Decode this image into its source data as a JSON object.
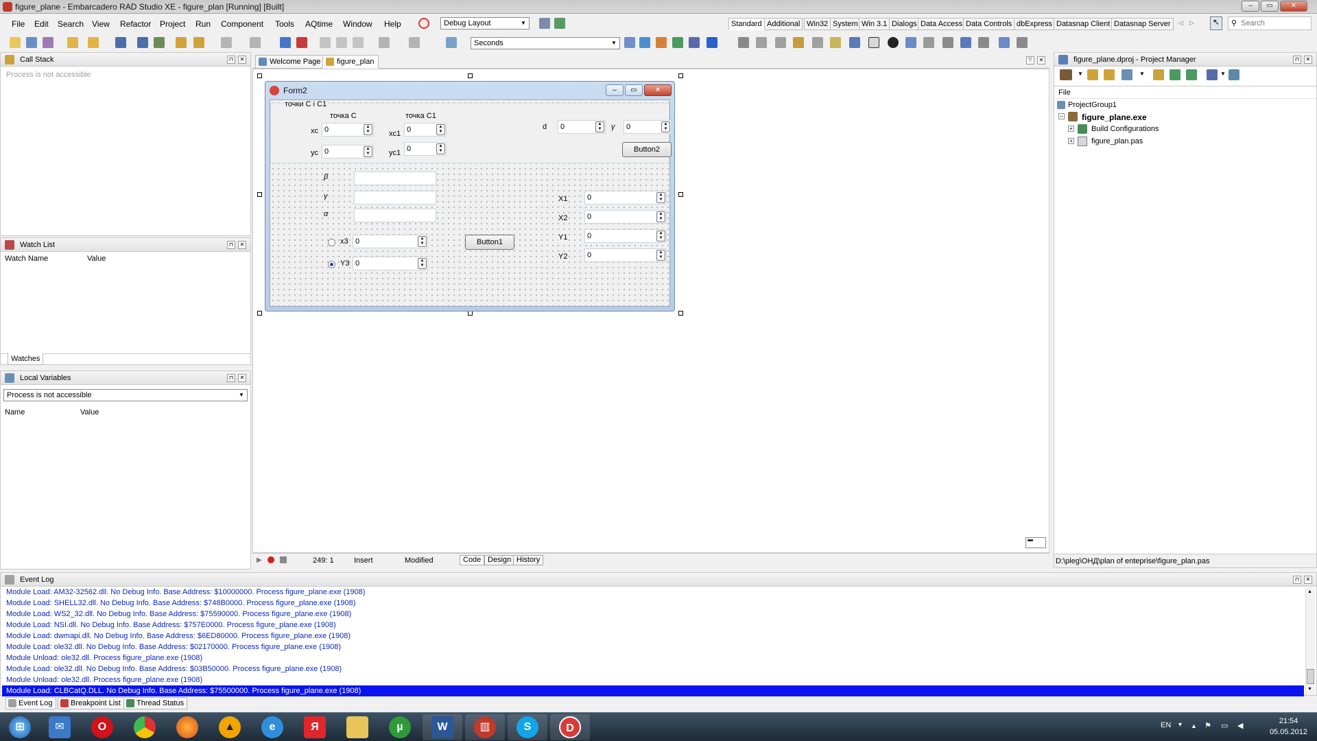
{
  "window": {
    "title": "figure_plane - Embarcadero RAD Studio XE - figure_plan [Running] [Built]"
  },
  "menu": [
    "File",
    "Edit",
    "Search",
    "View",
    "Refactor",
    "Project",
    "Run",
    "Component",
    "Tools",
    "AQtime",
    "Window",
    "Help"
  ],
  "layout_combo": "Debug Layout",
  "toolbar": {
    "timer_combo": "Seconds"
  },
  "palette_tabs": [
    "Standard",
    "Additional",
    "Win32",
    "System",
    "Win 3.1",
    "Dialogs",
    "Data Access",
    "Data Controls",
    "dbExpress",
    "Datasnap Client",
    "Datasnap Server"
  ],
  "search": {
    "placeholder": "Search"
  },
  "call_stack": {
    "title": "Call Stack",
    "message": "Process is not accessible"
  },
  "watch_list": {
    "title": "Watch List",
    "columns": [
      "Watch Name",
      "Value"
    ],
    "tab": "Watches"
  },
  "local_vars": {
    "title": "Local Variables",
    "combo": "Process is not accessible",
    "columns": [
      "Name",
      "Value"
    ]
  },
  "designer_tabs": [
    "Welcome Page",
    "figure_plan"
  ],
  "form": {
    "title": "Form2",
    "group_label": "точки C i C1",
    "point_c_label": "точка C",
    "point_c1_label": "точка C1",
    "xc_label": "xc",
    "yc_label": "yc",
    "xc1_label": "xc1",
    "yc1_label": "yc1",
    "d_label": "d",
    "gamma_top_label": "γ",
    "beta_label": "β",
    "gamma_label": "γ",
    "alpha_label": "α",
    "x3_label": "x3",
    "y3_label": "Y3",
    "x1_label": "X1",
    "x2_label": "X2",
    "y1_label": "Y1",
    "y2_label": "Y2",
    "zero": "0",
    "button1": "Button1",
    "button2": "Button2"
  },
  "editor_status": {
    "position": "249:   1",
    "mode": "Insert",
    "state": "Modified",
    "tabs": [
      "Code",
      "Design",
      "History"
    ]
  },
  "project_manager": {
    "title": "figure_plane.dproj - Project Manager",
    "file_label": "File",
    "tree": [
      "ProjectGroup1",
      "figure_plane.exe",
      "Build Configurations",
      "figure_plan.pas"
    ],
    "path": "D:\\pleg\\ОНД\\plan of enteprise\\figure_plan.pas"
  },
  "event_log": {
    "title": "Event Log",
    "lines": [
      "Module Load: AM32-32562.dll. No Debug Info. Base Address: $10000000. Process figure_plane.exe (1908)",
      "Module Load: SHELL32.dll. No Debug Info. Base Address: $748B0000. Process figure_plane.exe (1908)",
      "Module Load: WS2_32.dll. No Debug Info. Base Address: $75590000. Process figure_plane.exe (1908)",
      "Module Load: NSI.dll. No Debug Info. Base Address: $757E0000. Process figure_plane.exe (1908)",
      "Module Load: dwmapi.dll. No Debug Info. Base Address: $6ED80000. Process figure_plane.exe (1908)",
      "Module Load: ole32.dll. No Debug Info. Base Address: $02170000. Process figure_plane.exe (1908)",
      "Module Unload: ole32.dll. Process figure_plane.exe (1908)",
      "Module Load: ole32.dll. No Debug Info. Base Address: $03B50000. Process figure_plane.exe (1908)",
      "Module Unload: ole32.dll. Process figure_plane.exe (1908)",
      "Module Load: CLBCatQ.DLL. No Debug Info. Base Address: $75500000. Process figure_plane.exe (1908)"
    ],
    "bottom_tabs": [
      "Event Log",
      "Breakpoint List",
      "Thread Status"
    ]
  },
  "taskbar": {
    "apps": [
      "start",
      "mail",
      "opera",
      "chrome",
      "firefox",
      "aimp",
      "ie",
      "yandex",
      "explorer",
      "utorrent",
      "word",
      "app-red",
      "skype",
      "app-d"
    ],
    "lang": "EN",
    "time": "21:54",
    "date": "05.05.2012"
  }
}
